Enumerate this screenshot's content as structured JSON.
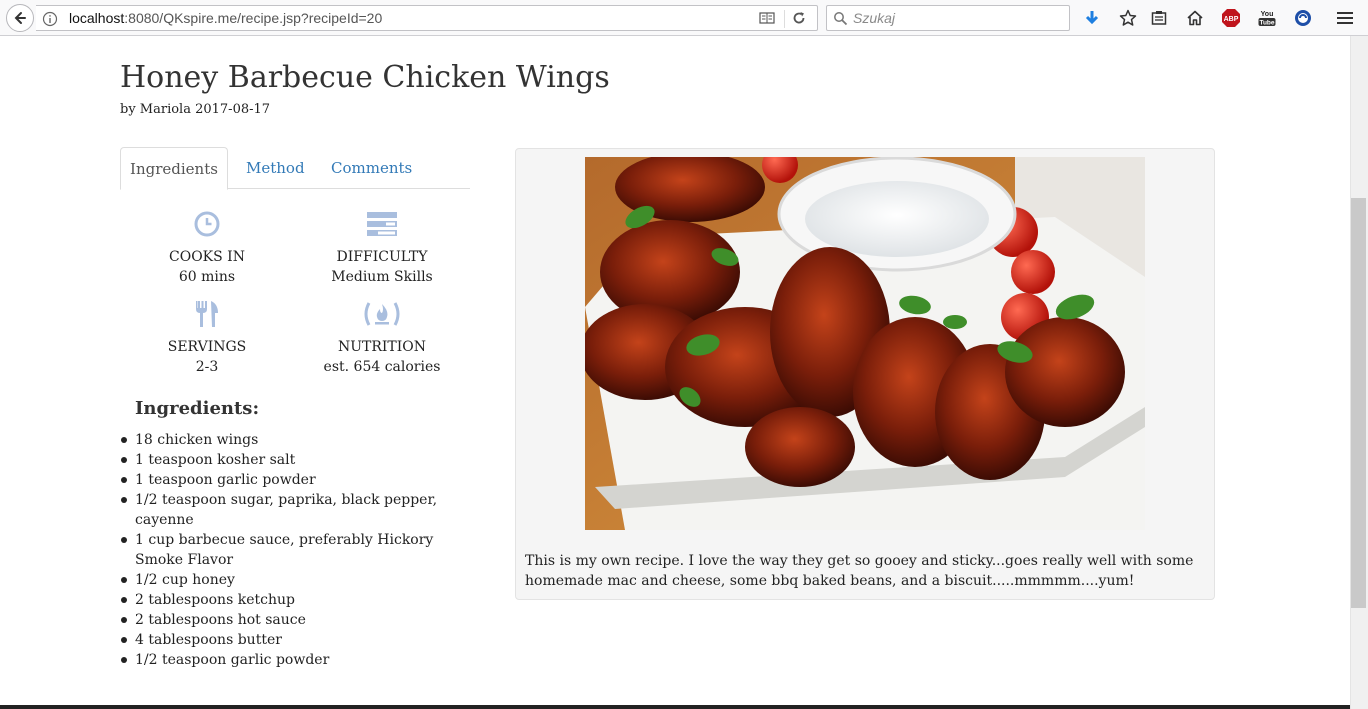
{
  "browser": {
    "url_host": "localhost",
    "url_rest": ":8080/QKspire.me/recipe.jsp?recipeId=20",
    "search_placeholder": "Szukaj",
    "icons": [
      "back-arrow-icon",
      "info-icon",
      "reader-view-icon",
      "reload-icon",
      "search-icon",
      "download-icon",
      "bookmark-star-icon",
      "library-icon",
      "home-icon",
      "adblock-icon",
      "youtube-icon",
      "extension-icon",
      "hamburger-menu-icon"
    ],
    "abp_label": "ABP",
    "youtube_label": "You\nTube"
  },
  "recipe": {
    "title": "Honey Barbecue Chicken Wings",
    "byline": "by Mariola 2017-08-17",
    "tabs": [
      {
        "label": "Ingredients",
        "active": true
      },
      {
        "label": "Method",
        "active": false
      },
      {
        "label": "Comments",
        "active": false
      }
    ],
    "stats": [
      {
        "label": "COOKS IN",
        "value": "60 mins",
        "icon": "clock-icon"
      },
      {
        "label": "DIFFICULTY",
        "value": "Medium Skills",
        "icon": "difficulty-icon"
      },
      {
        "label": "SERVINGS",
        "value": "2-3",
        "icon": "fork-knife-icon"
      },
      {
        "label": "NUTRITION",
        "value": "est. 654 calories",
        "icon": "flame-icon"
      }
    ],
    "ingredients_heading": "Ingredients:",
    "ingredients": [
      "18 chicken wings",
      "1 teaspoon kosher salt",
      "1 teaspoon garlic powder",
      "1/2 teaspoon sugar, paprika, black pepper, cayenne",
      "1 cup barbecue sauce, preferably Hickory Smoke Flavor",
      "1/2 cup honey",
      "2 tablespoons ketchup",
      "2 tablespoons hot sauce",
      "4 tablespoons butter",
      "1/2 teaspoon garlic powder"
    ],
    "description": "This is my own recipe. I love the way they get so gooey and sticky...goes really well with some homemade mac and cheese, some bbq baked beans, and a biscuit.....mmmmm....yum!"
  },
  "colors": {
    "link": "#337ab7",
    "icon": "#a9bede",
    "download": "#1e7fe0",
    "abp": "#c0141c"
  }
}
